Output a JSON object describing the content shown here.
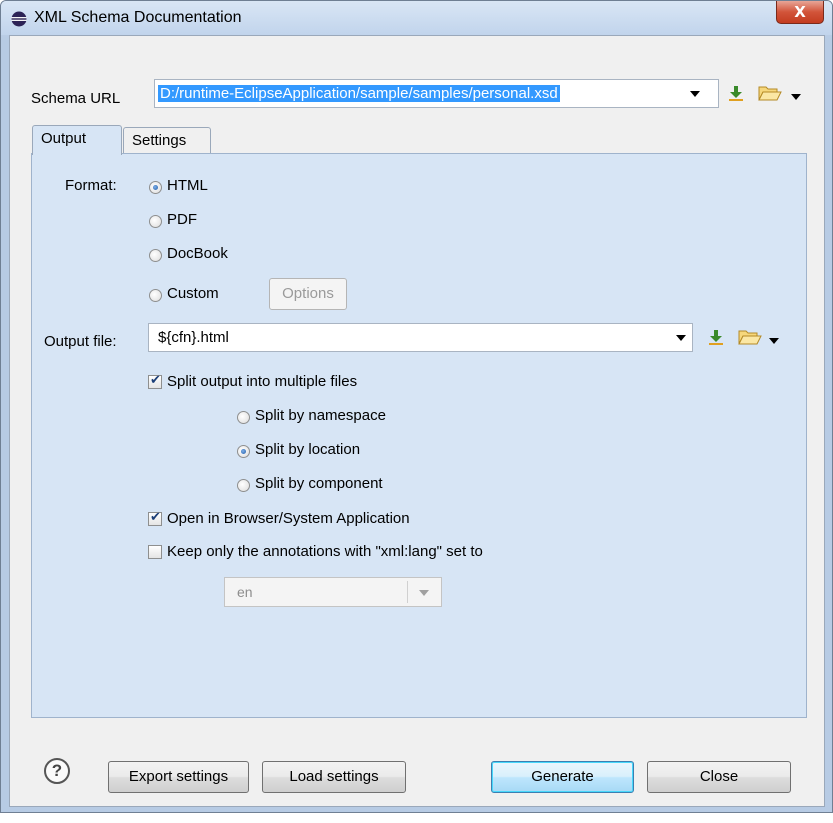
{
  "window": {
    "title": "XML Schema Documentation",
    "close_glyph": "X"
  },
  "schema": {
    "label": "Schema URL",
    "value": "D:/runtime-EclipseApplication/sample/samples/personal.xsd"
  },
  "tabs": [
    {
      "label": "Output",
      "active": true
    },
    {
      "label": "Settings",
      "active": false
    }
  ],
  "format": {
    "label": "Format:",
    "options": [
      {
        "label": "HTML",
        "selected": true
      },
      {
        "label": "PDF",
        "selected": false
      },
      {
        "label": "DocBook",
        "selected": false
      },
      {
        "label": "Custom",
        "selected": false
      }
    ],
    "options_button": "Options"
  },
  "output_file": {
    "label": "Output file:",
    "value": "${cfn}.html"
  },
  "split": {
    "label": "Split output into multiple files",
    "checked": true,
    "options": [
      {
        "label": "Split by namespace",
        "selected": false
      },
      {
        "label": "Split by location",
        "selected": true
      },
      {
        "label": "Split by component",
        "selected": false
      }
    ]
  },
  "open_browser": {
    "label": "Open in Browser/System Application",
    "checked": true
  },
  "keep_annotations": {
    "label": "Keep only the annotations with \"xml:lang\" set to",
    "checked": false,
    "lang_value": "en"
  },
  "footer": {
    "help_glyph": "?",
    "export_label": "Export settings",
    "load_label": "Load settings",
    "generate_label": "Generate",
    "close_label": "Close"
  },
  "icons": {
    "title": "eclipse-icon",
    "insert": "insert-editor-variable-icon",
    "browse": "folder-open-icon"
  }
}
